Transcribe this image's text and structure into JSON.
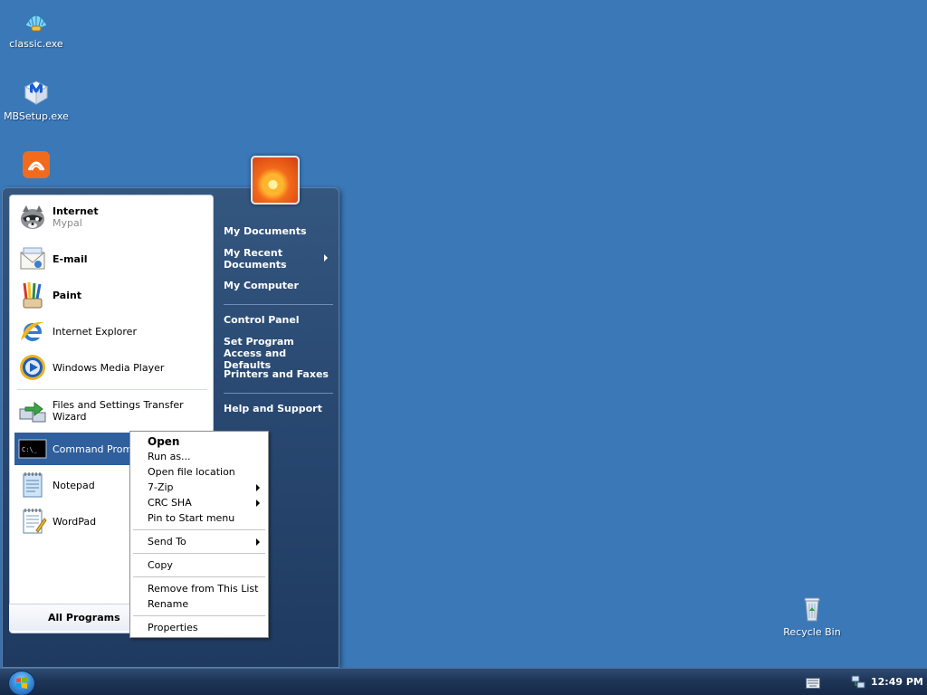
{
  "desktop": {
    "icons": [
      {
        "label": "classic.exe",
        "icon": "seashell-icon"
      },
      {
        "label": "MBSetup.exe",
        "icon": "malwarebytes-icon"
      },
      {
        "label": "",
        "icon": "orange-app-icon"
      },
      {
        "label": "Recycle Bin",
        "icon": "recycle-bin-icon"
      }
    ]
  },
  "start_menu": {
    "pinned": [
      {
        "name": "Internet",
        "sub": "Mypal",
        "icon": "raccoon-browser-icon"
      },
      {
        "name": "E-mail",
        "icon": "email-icon"
      },
      {
        "name": "Paint",
        "icon": "paint-icon"
      }
    ],
    "recent": [
      {
        "name": "Internet Explorer",
        "icon": "internet-explorer-icon"
      },
      {
        "name": "Windows Media Player",
        "icon": "media-player-icon"
      },
      {
        "name": "Files and Settings Transfer Wizard",
        "icon": "transfer-wizard-icon"
      },
      {
        "name": "Command Prompt",
        "icon": "command-prompt-icon"
      },
      {
        "name": "Notepad",
        "icon": "notepad-icon"
      },
      {
        "name": "WordPad",
        "icon": "wordpad-icon"
      }
    ],
    "all_programs": "All Programs",
    "right": {
      "my_documents": "My Documents",
      "my_recent_documents": "My Recent Documents",
      "my_computer": "My Computer",
      "control_panel": "Control Panel",
      "set_program_access": "Set Program Access and Defaults",
      "printers_faxes": "Printers and Faxes",
      "help_support": "Help and Support"
    }
  },
  "context_menu": {
    "items": [
      "Open",
      "Run as...",
      "Open file location",
      "7-Zip",
      "CRC SHA",
      "Pin to Start menu",
      "Send To",
      "Copy",
      "Remove from This List",
      "Rename",
      "Properties"
    ]
  },
  "taskbar": {
    "clock": "12:49 PM"
  }
}
